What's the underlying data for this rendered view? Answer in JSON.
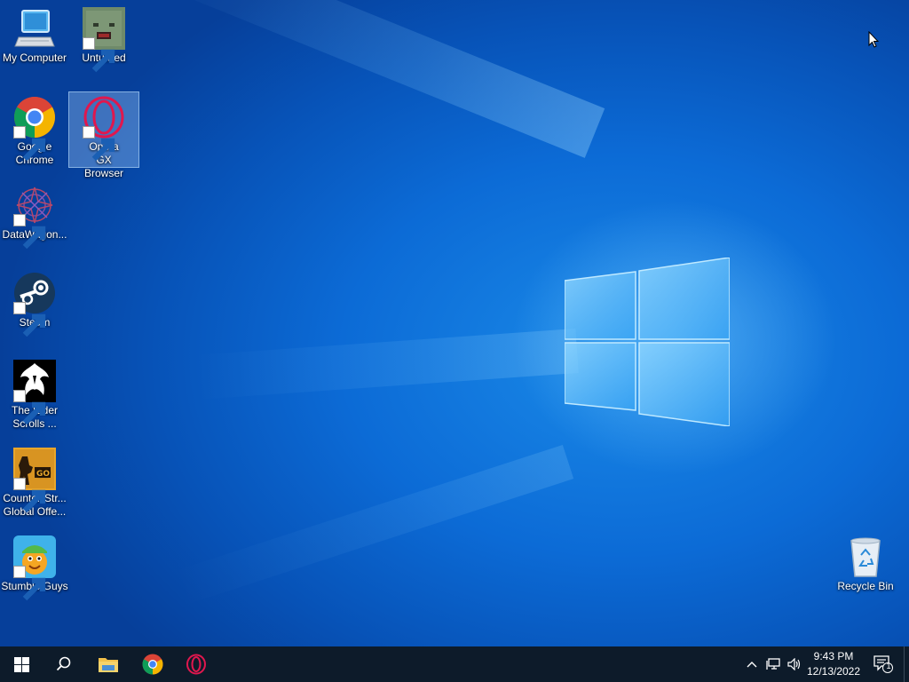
{
  "desktop": {
    "icons": [
      {
        "label": "My Computer"
      },
      {
        "label": "Unturned"
      },
      {
        "label": "Google Chrome"
      },
      {
        "label": "Opera GX Browser"
      },
      {
        "label": "DataWagon..."
      },
      {
        "label": "Steam"
      },
      {
        "label": "The Elder Scrolls ..."
      },
      {
        "label": "Counter-Str... Global Offe..."
      },
      {
        "label": "Stumble Guys"
      },
      {
        "label": "Recycle Bin"
      }
    ]
  },
  "taskbar": {
    "start": "windows-logo-icon",
    "search": "search-icon",
    "pinned": [
      "file-explorer-icon",
      "chrome-icon",
      "opera-gx-icon"
    ],
    "clock": {
      "time": "9:43 PM",
      "date": "12/13/2022"
    },
    "notifications": {
      "count": "1"
    }
  },
  "colors": {
    "taskbar": "#0d1b2a",
    "accent": "#0c6bd6",
    "opera": "#e0174e"
  }
}
